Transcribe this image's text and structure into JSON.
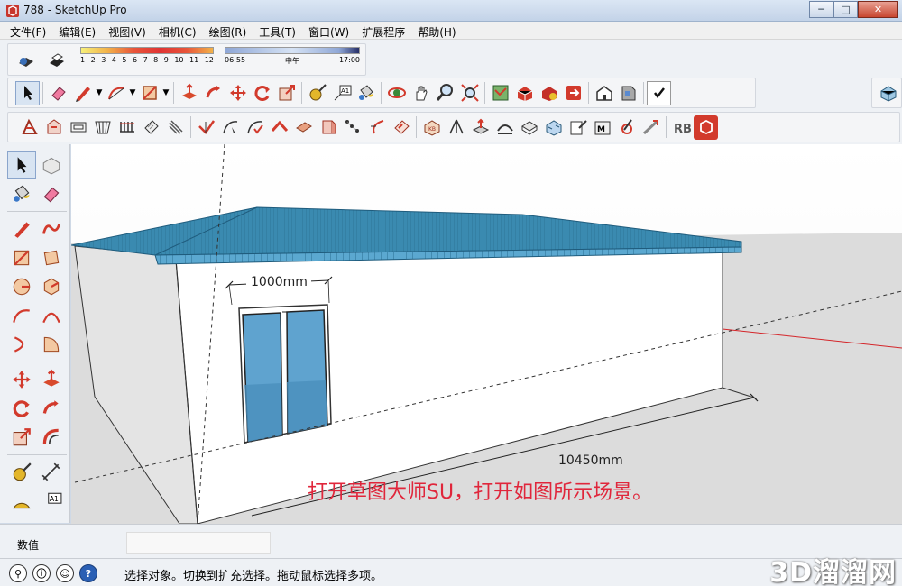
{
  "window": {
    "title": "788 - SketchUp Pro",
    "min": "─",
    "max": "□",
    "close": "✕"
  },
  "menu": [
    "文件(F)",
    "编辑(E)",
    "视图(V)",
    "相机(C)",
    "绘图(R)",
    "工具(T)",
    "窗口(W)",
    "扩展程序",
    "帮助(H)"
  ],
  "shadow": {
    "months": [
      "1",
      "2",
      "3",
      "4",
      "5",
      "6",
      "7",
      "8",
      "9",
      "10",
      "11",
      "12"
    ],
    "time_start": "06:55",
    "time_mid": "中午",
    "time_end": "17:00"
  },
  "scene": {
    "dim_width": "1000mm",
    "dim_length": "10450mm",
    "caption": "打开草图大师SU，打开如图所示场景。"
  },
  "colors": {
    "roof": "#3a8ab0",
    "window": "#5fa3cf",
    "caption": "#e0263b",
    "axis_red": "#d4262a"
  },
  "vcb": {
    "label": "数值",
    "value": ""
  },
  "status": {
    "message": "选择对象。切换到扩充选择。拖动鼠标选择多项。"
  },
  "watermark": "3D溜溜网"
}
